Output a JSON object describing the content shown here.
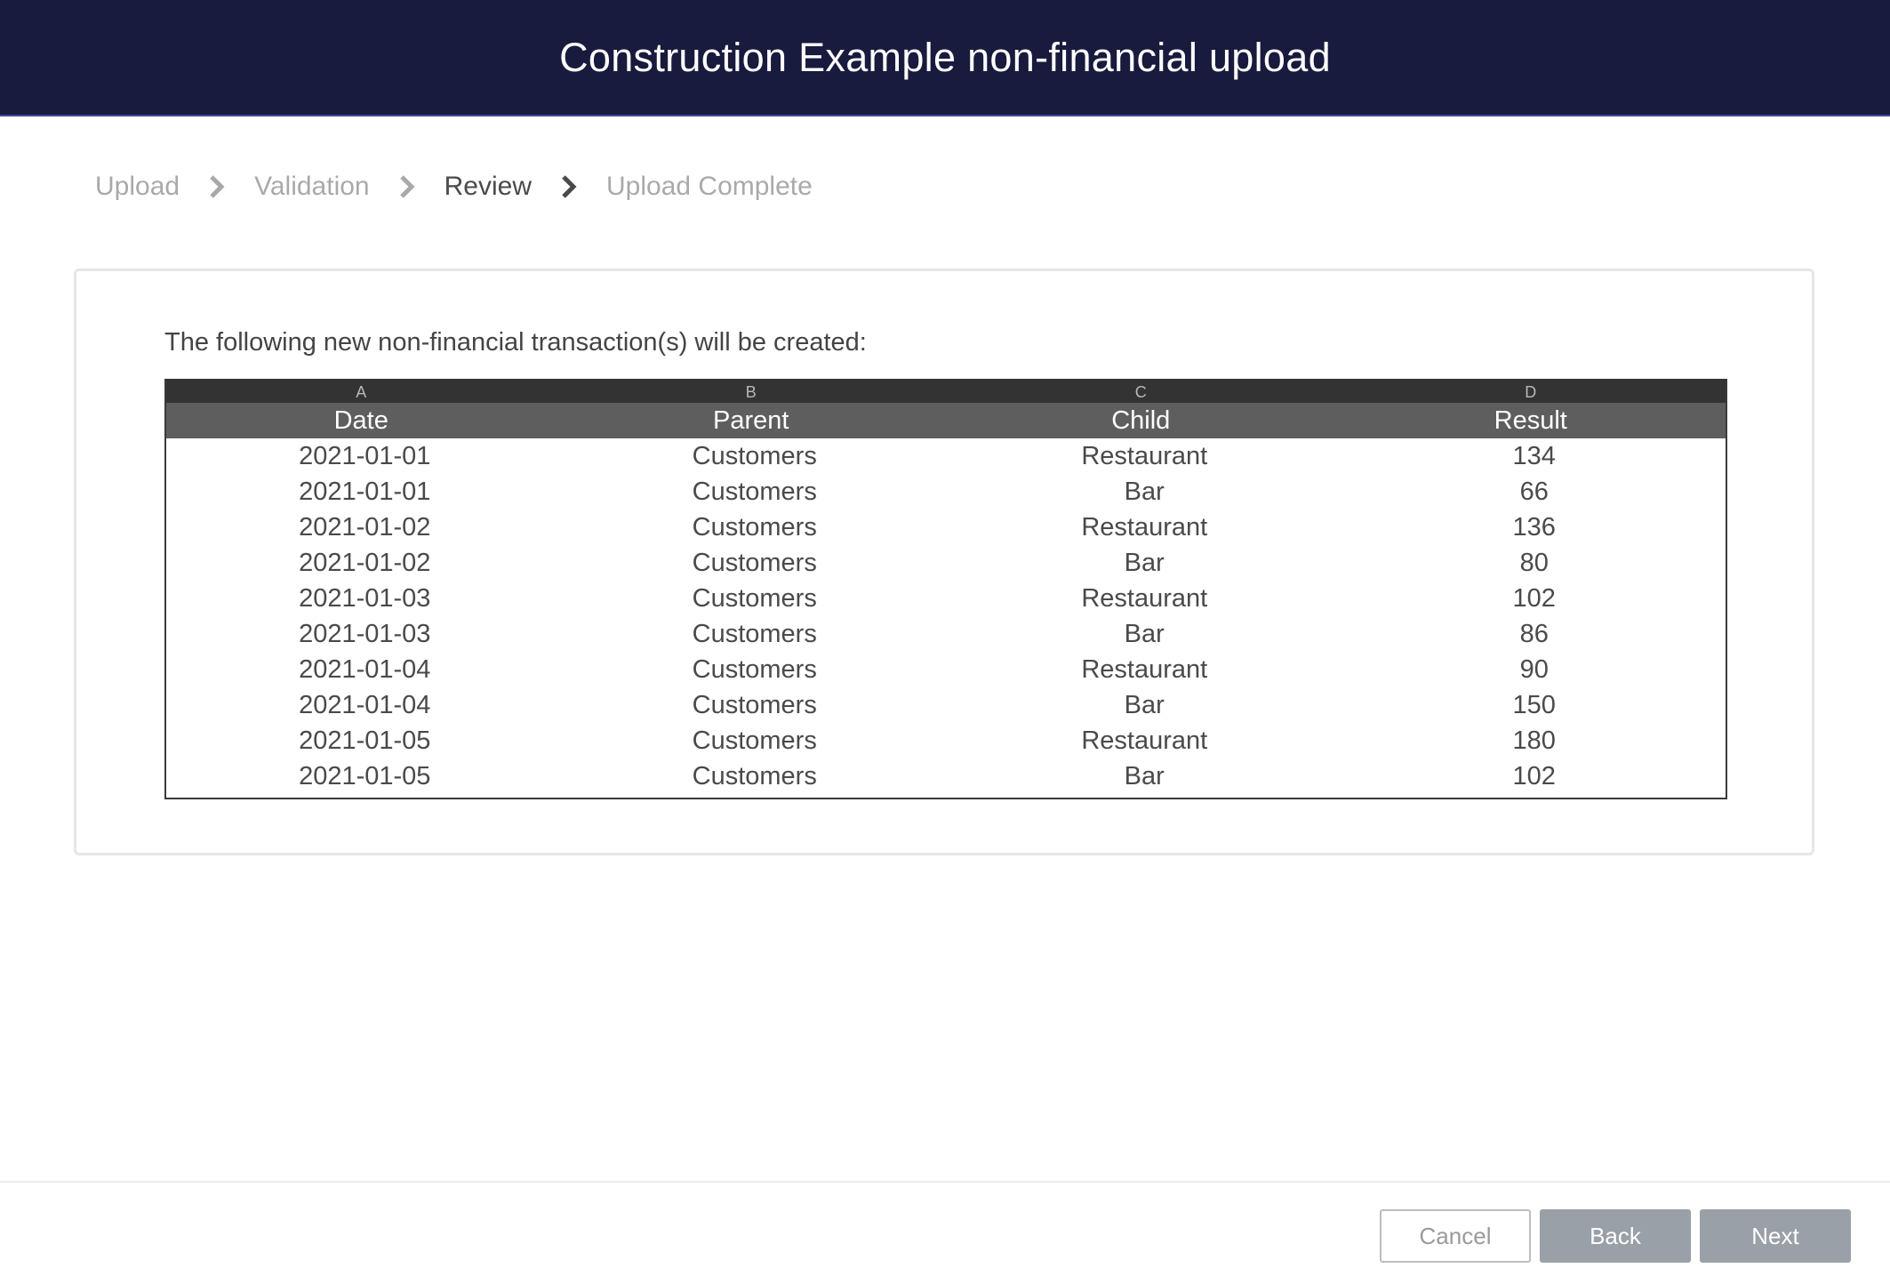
{
  "header": {
    "title": "Construction Example non-financial upload"
  },
  "breadcrumb": {
    "steps": [
      {
        "label": "Upload",
        "active": false
      },
      {
        "label": "Validation",
        "active": false
      },
      {
        "label": "Review",
        "active": true
      },
      {
        "label": "Upload Complete",
        "active": false
      }
    ]
  },
  "panel": {
    "intro": "The following new non-financial transaction(s) will be created:"
  },
  "table": {
    "column_letters": [
      "A",
      "B",
      "C",
      "D"
    ],
    "columns": [
      "Date",
      "Parent",
      "Child",
      "Result"
    ],
    "rows": [
      [
        "2021-01-01",
        "Customers",
        "Restaurant",
        "134"
      ],
      [
        "2021-01-01",
        "Customers",
        "Bar",
        "66"
      ],
      [
        "2021-01-02",
        "Customers",
        "Restaurant",
        "136"
      ],
      [
        "2021-01-02",
        "Customers",
        "Bar",
        "80"
      ],
      [
        "2021-01-03",
        "Customers",
        "Restaurant",
        "102"
      ],
      [
        "2021-01-03",
        "Customers",
        "Bar",
        "86"
      ],
      [
        "2021-01-04",
        "Customers",
        "Restaurant",
        "90"
      ],
      [
        "2021-01-04",
        "Customers",
        "Bar",
        "150"
      ],
      [
        "2021-01-05",
        "Customers",
        "Restaurant",
        "180"
      ],
      [
        "2021-01-05",
        "Customers",
        "Bar",
        "102"
      ]
    ]
  },
  "footer": {
    "cancel_label": "Cancel",
    "back_label": "Back",
    "next_label": "Next"
  },
  "colors": {
    "header_bg": "#181b3d",
    "button_disabled": "#9aa0a8",
    "sheet_letter_bar": "#333333",
    "sheet_header_bar": "#5e5e5e"
  },
  "icons": {
    "breadcrumb_separator": "chevron-right-icon"
  }
}
